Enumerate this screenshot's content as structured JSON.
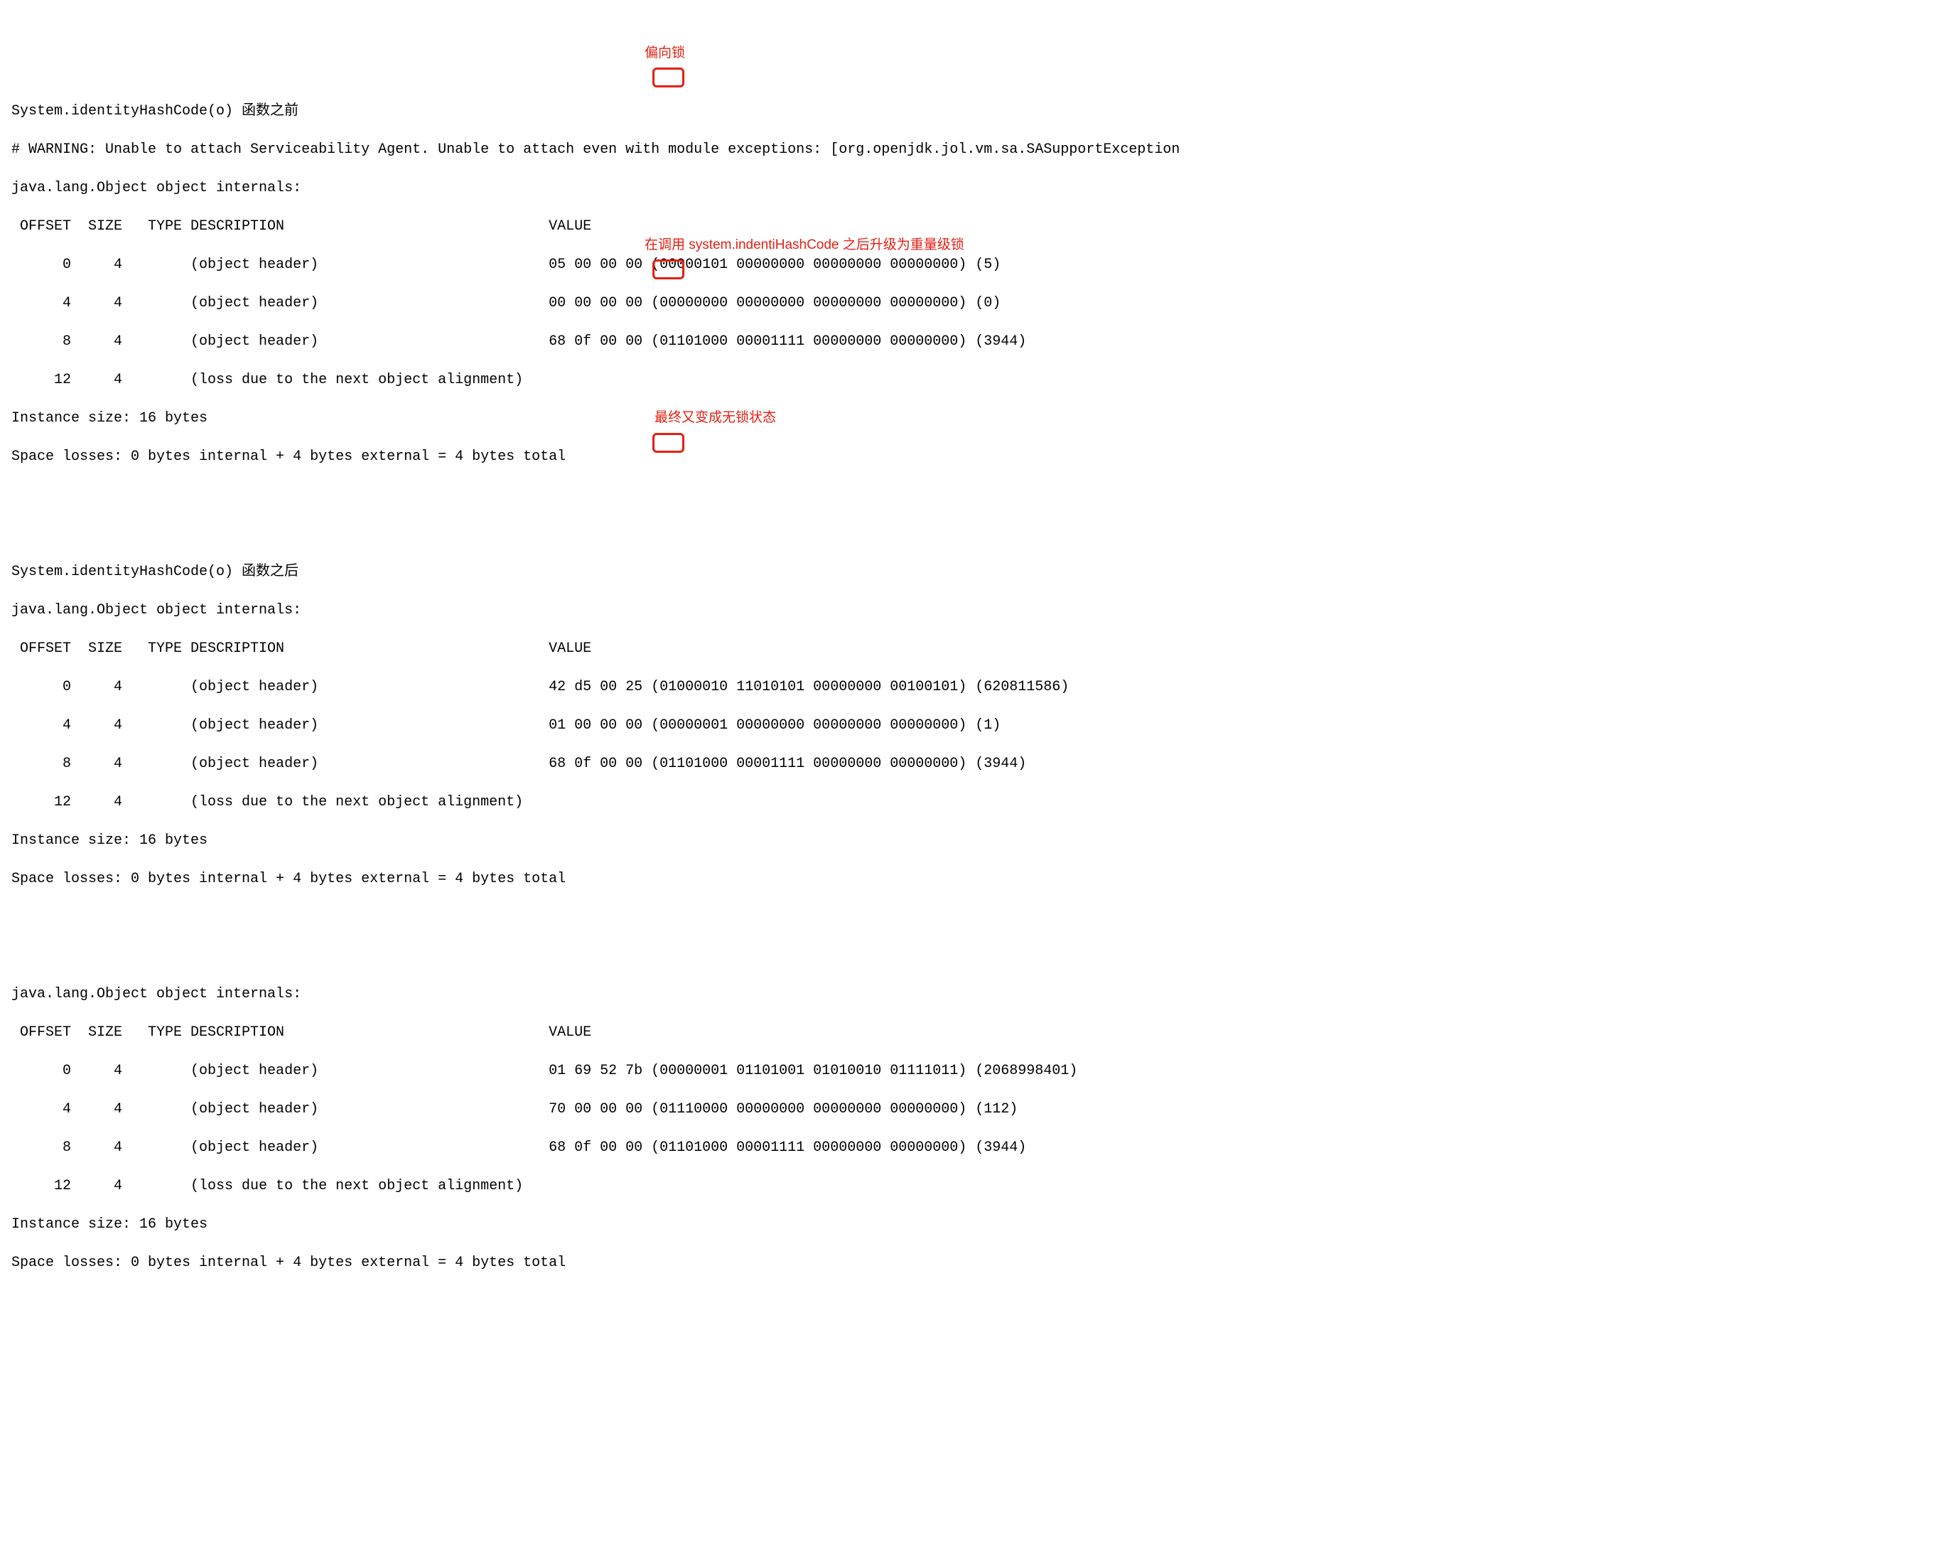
{
  "blocks": {
    "b1": {
      "preamble": "System.identityHashCode(o) 函数之前",
      "warning": "# WARNING: Unable to attach Serviceability Agent. Unable to attach even with module exceptions: [org.openjdk.jol.vm.sa.SASupportException",
      "internals_header": "java.lang.Object object internals:",
      "cols": " OFFSET  SIZE   TYPE DESCRIPTION                               VALUE",
      "rows": [
        "      0     4        (object header)                           05 00 00 00 (00000101 00000000 00000000 00000000) (5)",
        "      4     4        (object header)                           00 00 00 00 (00000000 00000000 00000000 00000000) (0)",
        "      8     4        (object header)                           68 0f 00 00 (01101000 00001111 00000000 00000000) (3944)",
        "     12     4        (loss due to the next object alignment)"
      ],
      "instance_size": "Instance size: 16 bytes",
      "space_losses": "Space losses: 0 bytes internal + 4 bytes external = 4 bytes total"
    },
    "b2": {
      "preamble": "System.identityHashCode(o) 函数之后",
      "internals_header": "java.lang.Object object internals:",
      "cols": " OFFSET  SIZE   TYPE DESCRIPTION                               VALUE",
      "rows": [
        "      0     4        (object header)                           42 d5 00 25 (01000010 11010101 00000000 00100101) (620811586)",
        "      4     4        (object header)                           01 00 00 00 (00000001 00000000 00000000 00000000) (1)",
        "      8     4        (object header)                           68 0f 00 00 (01101000 00001111 00000000 00000000) (3944)",
        "     12     4        (loss due to the next object alignment)"
      ],
      "instance_size": "Instance size: 16 bytes",
      "space_losses": "Space losses: 0 bytes internal + 4 bytes external = 4 bytes total"
    },
    "b3": {
      "internals_header": "java.lang.Object object internals:",
      "cols": " OFFSET  SIZE   TYPE DESCRIPTION                               VALUE",
      "rows": [
        "      0     4        (object header)                           01 69 52 7b (00000001 01101001 01010010 01111011) (2068998401)",
        "      4     4        (object header)                           70 00 00 00 (01110000 00000000 00000000 00000000) (112)",
        "      8     4        (object header)                           68 0f 00 00 (01101000 00001111 00000000 00000000) (3944)",
        "     12     4        (loss due to the next object alignment)"
      ],
      "instance_size": "Instance size: 16 bytes",
      "space_losses": "Space losses: 0 bytes internal + 4 bytes external = 4 bytes total"
    }
  },
  "annotations": {
    "a1": "偏向锁",
    "a2": "在调用 system.indentiHashCode 之后升级为重量级锁",
    "a3": "最终又变成无锁状态"
  }
}
